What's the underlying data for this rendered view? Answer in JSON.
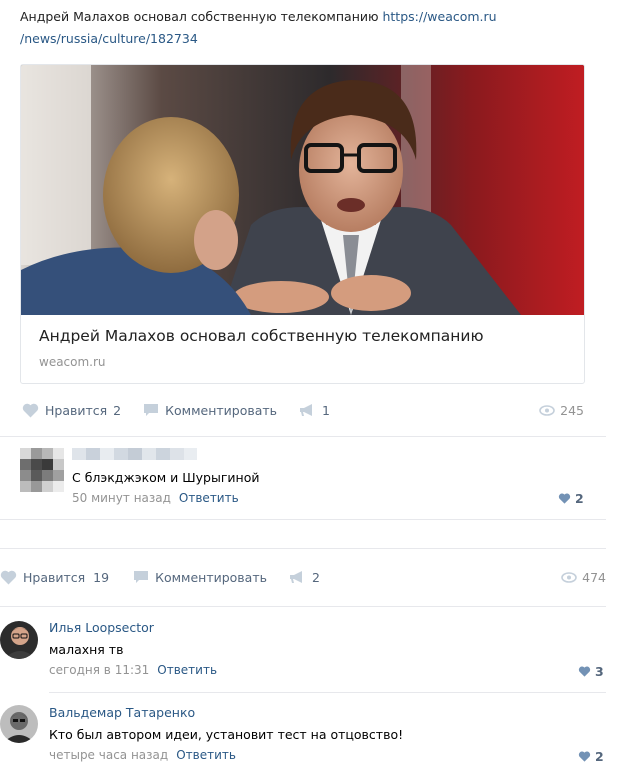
{
  "post1": {
    "text": "Андрей Малахов основал собственную телекомпанию",
    "url_line1": "https://weacom.ru",
    "url_line2": "/news/russia/culture/182734",
    "card": {
      "title": "Андрей Малахов основал собственную телекомпанию",
      "domain": "weacom.ru"
    },
    "actions": {
      "like_label": "Нравится",
      "like_count": "2",
      "comment_label": "Комментировать",
      "share_count": "1",
      "views": "245"
    },
    "comment": {
      "text": "С блэкджэком и Шурыгиной",
      "time": "50 минут назад",
      "reply": "Ответить",
      "likes": "2"
    }
  },
  "post2": {
    "actions": {
      "like_label": "Нравится",
      "like_count": "19",
      "comment_label": "Комментировать",
      "share_count": "2",
      "views": "474"
    },
    "comments": [
      {
        "author": "Илья Loopsector",
        "text": "малахня тв",
        "time": "сегодня в 11:31",
        "reply": "Ответить",
        "likes": "3"
      },
      {
        "author": "Вальдемар Татаренко",
        "text": "Кто был автором идеи, установит тест на отцовство!",
        "time": "четыре часа назад",
        "reply": "Ответить",
        "likes": "2"
      }
    ]
  },
  "colors": {
    "link": "#2a5885",
    "muted": "#939393",
    "action": "#55677d",
    "divider": "#e7e8ec"
  }
}
